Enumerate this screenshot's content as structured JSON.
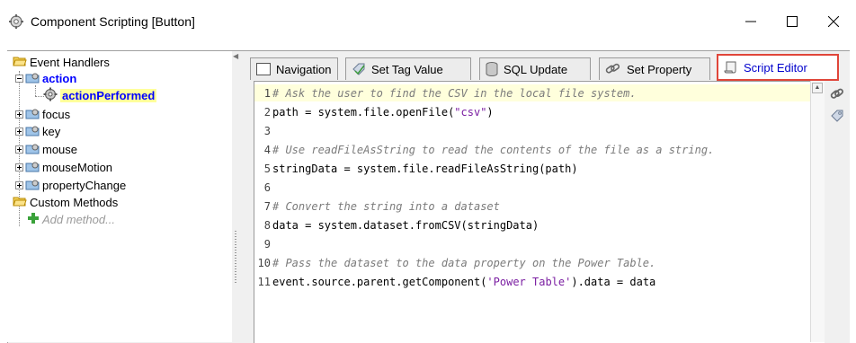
{
  "window": {
    "title": "Component Scripting [Button]",
    "minimize_label": "—",
    "maximize_label": "☐",
    "close_label": "✕"
  },
  "tree": {
    "event_handlers": "Event Handlers",
    "action": "action",
    "action_performed": "actionPerformed",
    "focus": "focus",
    "key": "key",
    "mouse": "mouse",
    "mouse_motion": "mouseMotion",
    "property_change": "propertyChange",
    "custom_methods": "Custom Methods",
    "add_method": "Add method..."
  },
  "tabs": {
    "navigation": "Navigation",
    "set_tag_value": "Set Tag Value",
    "sql_update": "SQL Update",
    "set_property": "Set Property",
    "script_editor": "Script Editor"
  },
  "editor": {
    "lines": [
      {
        "n": "1",
        "comment": "# Ask the user to find the CSV in the local file system."
      },
      {
        "n": "2",
        "pre": "path = system.file.openFile(",
        "str": "\"csv\"",
        "post": ")"
      },
      {
        "n": "3"
      },
      {
        "n": "4",
        "comment": "# Use readFileAsString to read the contents of the file as a string."
      },
      {
        "n": "5",
        "pre": "stringData = system.file.readFileAsString(path)"
      },
      {
        "n": "6"
      },
      {
        "n": "7",
        "comment": "# Convert the string into a dataset"
      },
      {
        "n": "8",
        "pre": "data = system.dataset.fromCSV(stringData)"
      },
      {
        "n": "9"
      },
      {
        "n": "10",
        "comment": "# Pass the dataset to the data property on the Power Table."
      },
      {
        "n": "11",
        "pre": "event.source.parent.getComponent(",
        "str": "'Power Table'",
        "post": ").data = data"
      }
    ]
  },
  "colors": {
    "active_tab_border": "#e0463a",
    "selected_text": "#0000ff",
    "current_line": "#ffffdc",
    "string": "#7b1fa2",
    "comment": "#7b7b7b"
  }
}
